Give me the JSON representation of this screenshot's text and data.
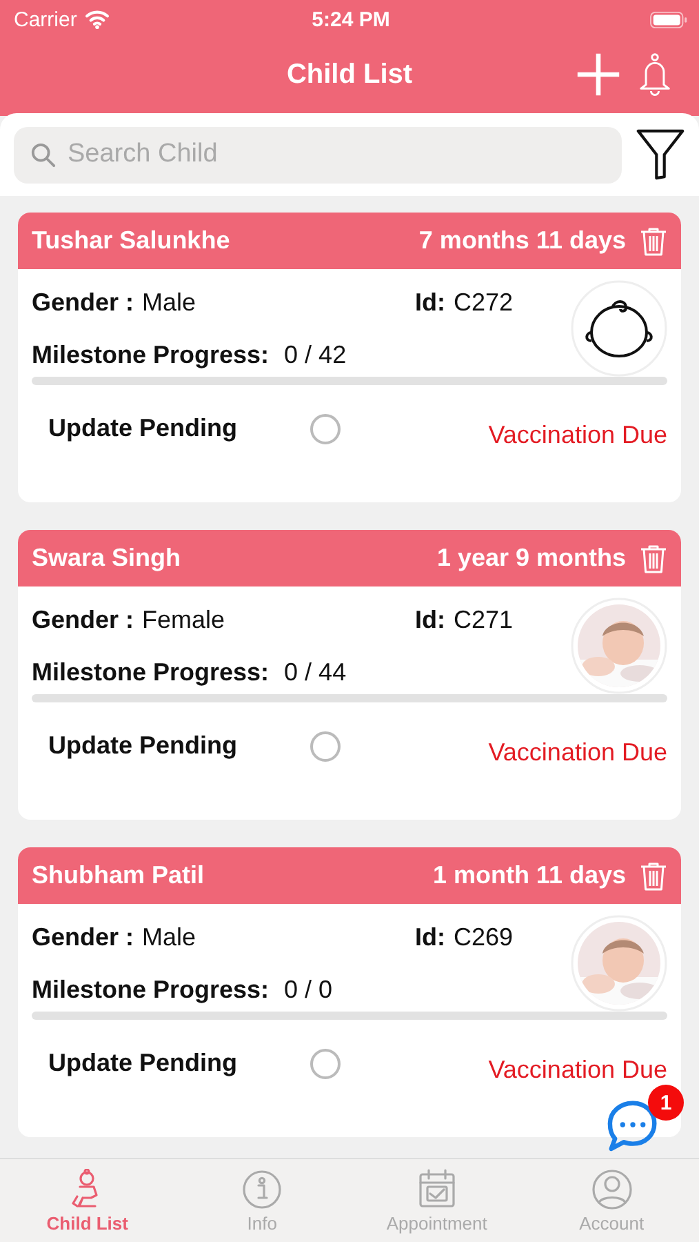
{
  "status_bar": {
    "carrier": "Carrier",
    "time": "5:24 PM"
  },
  "nav": {
    "title": "Child List"
  },
  "search": {
    "placeholder": "Search Child"
  },
  "children": [
    {
      "name": "Tushar Salunkhe",
      "age": "7 months 11 days",
      "gender_label": "Gender :",
      "gender": "Male",
      "id_label": "Id:",
      "id": "C272",
      "progress_label": "Milestone Progress:",
      "progress": "0 / 42",
      "level": 0,
      "update_label": "Update Pending",
      "checked": false,
      "due": "Vaccination Due",
      "kind": "icon"
    },
    {
      "name": "Swara Singh",
      "age": "1 year 9 months",
      "gender_label": "Gender :",
      "gender": "Female",
      "id_label": "Id:",
      "id": "C271",
      "progress_label": "Milestone Progress:",
      "progress": "0 / 44",
      "level": 0,
      "update_label": "Update Pending",
      "checked": false,
      "due": "Vaccination Due",
      "kind": "picture"
    },
    {
      "name": "Shubham Patil",
      "age": "1 month 11 days",
      "gender_label": "Gender :",
      "gender": "Male",
      "id_label": "Id:",
      "id": "C269",
      "progress_label": "Milestone Progress:",
      "progress": "0 / 0",
      "level": 0,
      "update_label": "Update Pending",
      "checked": false,
      "due": "Vaccination Due",
      "kind": "picture"
    }
  ],
  "chat": {
    "badge": "1"
  },
  "tabs": [
    {
      "label": "Child List",
      "selected": true
    },
    {
      "label": "Info",
      "selected": false
    },
    {
      "label": "Appointment",
      "selected": false
    },
    {
      "label": "Account",
      "selected": false
    }
  ]
}
